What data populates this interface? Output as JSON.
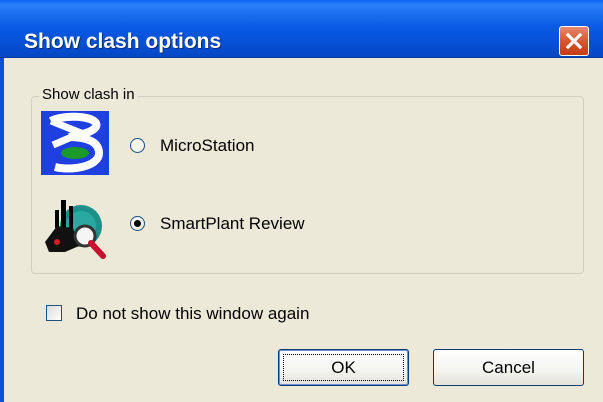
{
  "window": {
    "title": "Show clash options",
    "close_icon": "close-icon"
  },
  "group": {
    "legend": "Show clash in",
    "options": [
      {
        "label": "MicroStation",
        "icon": "microstation-logo-icon",
        "checked": false
      },
      {
        "label": "SmartPlant Review",
        "icon": "smartplant-review-icon",
        "checked": true
      }
    ]
  },
  "dont_show_again": {
    "label": "Do not show this window again",
    "checked": false
  },
  "buttons": {
    "ok": "OK",
    "cancel": "Cancel"
  },
  "colors": {
    "titlebar": "#0b5be6",
    "dialog_bg": "#ece9d8",
    "close_button": "#d9562f"
  }
}
